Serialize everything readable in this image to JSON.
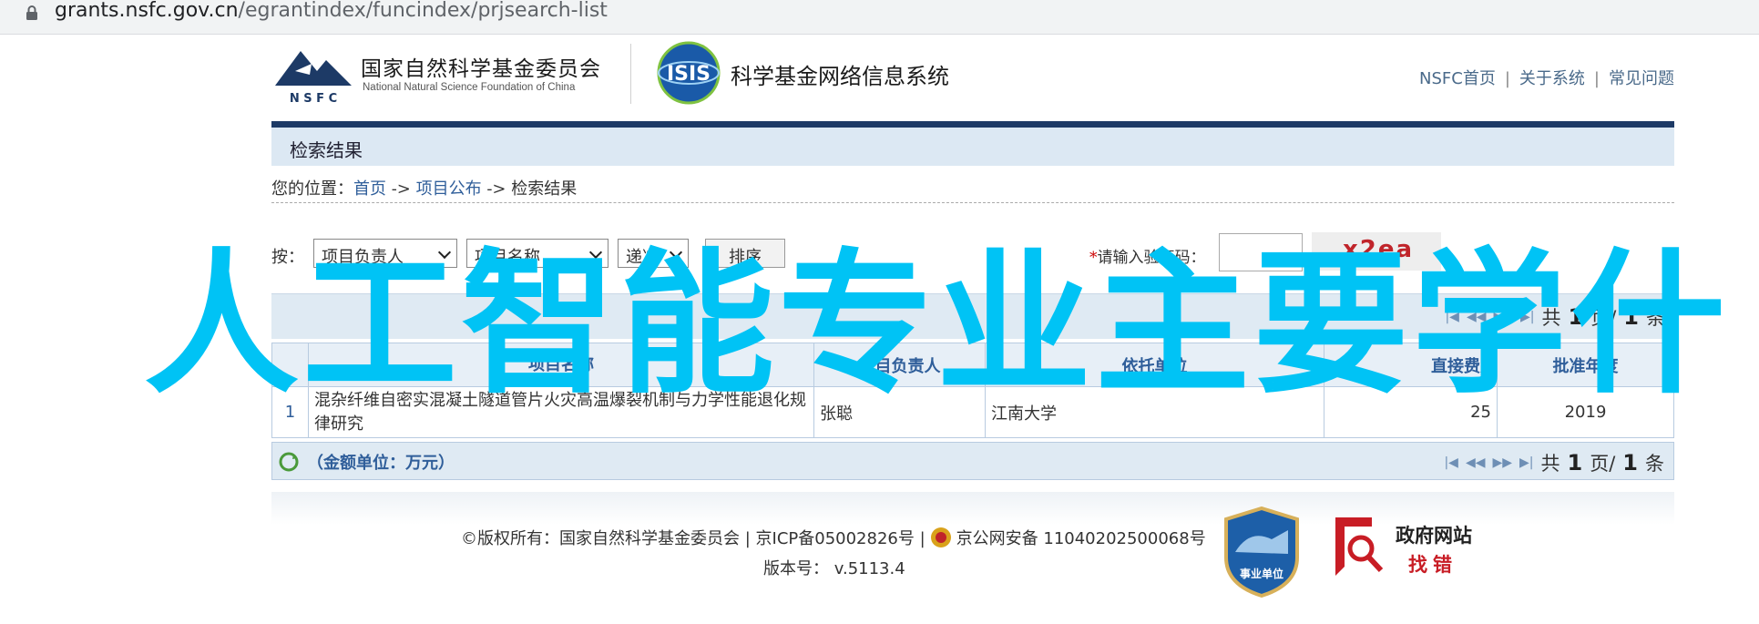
{
  "browser": {
    "url_host": "grants.nsfc.gov.cn",
    "url_path": "/egrantindex/funcindex/prjsearch-list"
  },
  "header": {
    "org_name_cn": "国家自然科学基金委员会",
    "org_name_en": "National Natural Science Foundation of China",
    "nsfc_letters": "N S F C",
    "isis_text": "ISIS",
    "system_name": "科学基金网络信息系统",
    "links": [
      "NSFC首页",
      "关于系统",
      "常见问题"
    ]
  },
  "page": {
    "title": "检索结果",
    "breadcrumb_prefix": "您的位置：",
    "breadcrumb": [
      "首页",
      "项目公布",
      "检索结果"
    ],
    "breadcrumb_sep": " -> "
  },
  "search": {
    "by_label": "按：",
    "sort1": "项目负责人",
    "sort2": "项目名称",
    "order": "递减",
    "sort_button": "排序",
    "captcha_required_mark": "*",
    "captcha_label": "请输入验证码：",
    "captcha_code": "x2ea"
  },
  "table": {
    "columns": [
      "项目名称",
      "项目负责人",
      "依托单位",
      "直接费用",
      "批准年度"
    ],
    "rows": [
      {
        "index": "1",
        "name": "混杂纤维自密实混凝土隧道管片火灾高温爆裂机制与力学性能退化规律研究",
        "leader": "张聪",
        "org": "江南大学",
        "fee": "25",
        "year": "2019"
      }
    ],
    "unit_note": "（金额单位：万元）",
    "pager": {
      "total_pages_prefix": "共",
      "current": "1",
      "pages_suffix": "页/",
      "total": "1",
      "items_suffix": "条"
    }
  },
  "footer": {
    "copyright": "©版权所有：国家自然科学基金委员会 | 京ICP备05002826号 |",
    "police": "京公网安备 11040202500068号",
    "version": "版本号： v.5113.4",
    "badge_unit": "事业单位",
    "gov_badge_line1": "政府网站",
    "gov_badge_line2": "找错"
  },
  "overlay_title": "人工智能专业主要学什",
  "colors": {
    "nav_bar": "#1d3a66",
    "title_bar": "#dce8f3",
    "link": "#2f5e9a",
    "overlay": "#00c3f5",
    "gov_red": "#c81d25"
  }
}
